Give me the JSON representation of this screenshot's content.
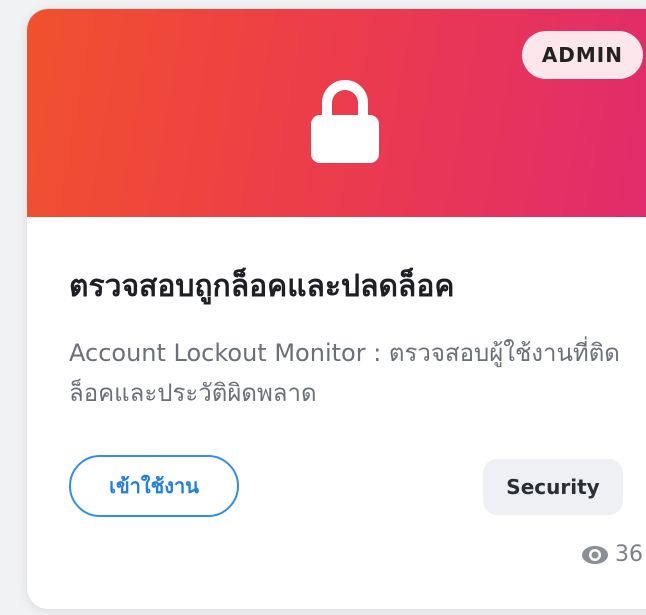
{
  "card": {
    "badge": "ADMIN",
    "title": "ตรวจสอบถูกล็อคและปลดล็อค",
    "description": "Account Lockout Monitor : ตรวจสอบผู้ใช้งานที่ติดล็อคและประวัติผิดพลาด",
    "action_label": "เข้าใช้งาน",
    "category": "Security",
    "views": "36"
  },
  "icons": {
    "banner": "lock-icon",
    "views": "eye-icon"
  },
  "colors": {
    "banner_start": "#f1512d",
    "banner_end": "#e02a6e",
    "accent": "#2f8fea"
  }
}
